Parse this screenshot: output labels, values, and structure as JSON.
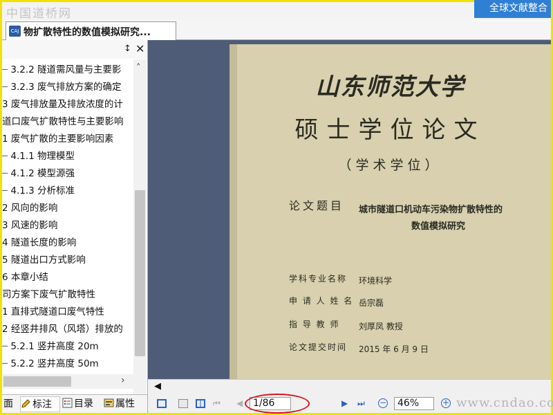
{
  "banner": {
    "watermark": "中国道桥网",
    "button_label": "全球文献整合"
  },
  "document_tab": {
    "icon_text": "CAJ",
    "title": "物扩散特性的数值模拟研究..."
  },
  "sidebar": {
    "pin": "↕",
    "close": "✕",
    "toc": [
      "┈ 3.2.2 隧道需风量与主要影",
      "┈ 3.2.3 废气排放方案的确定",
      "3 废气排放量及排放浓度的计",
      "道口废气扩散特性与主要影响",
      "1 废气扩散的主要影响因素",
      "┈ 4.1.1 物理模型",
      "┈ 4.1.2 模型源强",
      "┈ 4.1.3 分析标准",
      "2 风向的影响",
      "3 风速的影响",
      "4 隧道长度的影响",
      "5 隧道出口方式影响",
      "6 本章小结",
      "司方案下废气扩散特性",
      "1 直排式隧道口废气特性",
      "2 经竖井排风（风塔）排放的",
      "┈ 5.2.1 竖井高度 20m",
      "┈ 5.2.2 竖井高度 50m"
    ],
    "tabs": [
      "面",
      "标注",
      "目录",
      "属性"
    ]
  },
  "page": {
    "university": "山东师范大学",
    "thesis_type": "硕士学位论文",
    "degree_type": "（学术学位）",
    "title_label": "论文题目",
    "title_line1": "城市隧道口机动车污染物扩散特性的",
    "title_line2": "数值模拟研究",
    "fields": [
      {
        "label": "学科专业名称",
        "value": "环境科学"
      },
      {
        "label": "申 请 人 姓 名",
        "value": "岳宗磊"
      },
      {
        "label": "指  导  教  师",
        "value": "刘厚凤  教授"
      },
      {
        "label": "论文提交时间",
        "value": "2015    年 6    月 9    日"
      }
    ]
  },
  "viewer": {
    "hscroll_left": "◀"
  },
  "toolbar": {
    "page_value": "1/86",
    "zoom_value": "46%",
    "watermark": "www.cndao.com",
    "first": "⏮",
    "prev": "◀",
    "next": "▶",
    "last": "⏭",
    "zoom_out": "−",
    "zoom_in": "+"
  }
}
